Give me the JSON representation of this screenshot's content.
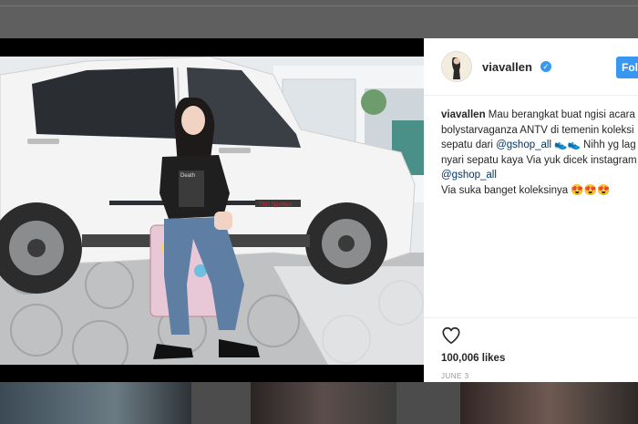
{
  "post": {
    "username": "viavallen",
    "follow_label": "Fol",
    "caption": {
      "username": "viavallen",
      "line1": "Mau berangkat buat ngisi acara",
      "line2": "bolystarvaganza ANTV di temenin koleksi",
      "line3_a": "sepatu dari ",
      "line3_mention": "@gshop_all",
      "line3_b": " 👟👟  Nihh yg lag",
      "line4": "nyari sepatu kaya Via yuk dicek instagram",
      "line5_mention": "@gshop_all",
      "line6": "Via suka banget koleksinya 😍😍😍"
    },
    "likes": "100,006 likes",
    "date": "JUNE 3"
  },
  "photo": {
    "shirt_text": "Death",
    "car_badge": "TRD Sportivo"
  },
  "icons": {
    "verified": "verified-badge-icon",
    "heart": "heart-icon"
  },
  "colors": {
    "accent": "#3897f0",
    "mention": "#003569",
    "text": "#262626"
  }
}
